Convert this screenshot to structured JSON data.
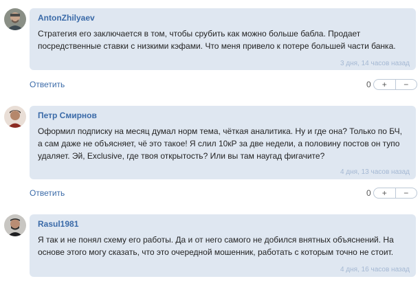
{
  "comments": [
    {
      "author": "AntonZhilyaev",
      "text": "Стратегия его заключается в том, чтобы срубить как можно больше бабла. Продает посредственные ставки с низкими кэфами. Что меня привело к потере большей части банка.",
      "time": "3 дня, 14 часов назад",
      "reply": "Ответить",
      "score": "0",
      "plus": "+",
      "minus": "−"
    },
    {
      "author": "Петр Смирнов",
      "text": "Оформил подписку на месяц думал норм тема, чёткая аналитика. Ну и где она? Только по БЧ, а сам даже не объясняет, чё это такое! Я слил 10кР за две недели, а половину постов он тупо удаляет. Эй, Exclusive, где твоя открытость? Или вы там наугад фигачите?",
      "time": "4 дня, 13 часов назад",
      "reply": "Ответить",
      "score": "0",
      "plus": "+",
      "minus": "−"
    },
    {
      "author": "Rasul1981",
      "text": "Я так и не понял схему его работы. Да и от него самого не добился внятных объяснений. На основе этого могу сказать, что это очередной мошенник, работать с которым точно не стоит.",
      "time": "4 дня, 16 часов назад"
    }
  ]
}
